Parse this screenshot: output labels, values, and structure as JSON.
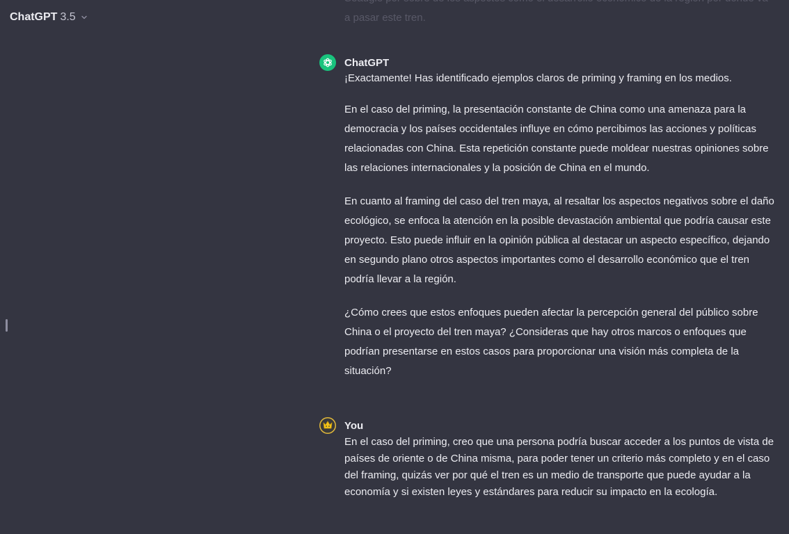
{
  "header": {
    "model_name": "ChatGPT",
    "model_version": "3.5"
  },
  "previous_message_tail": "Seaugie por sobre de los aspectos como el desarrollo económico de la región por donde va a pasar este tren.",
  "messages": [
    {
      "author": "ChatGPT",
      "role": "assistant",
      "avatar_icon": "openai-logo-icon",
      "paragraphs": [
        "¡Exactamente! Has identificado ejemplos claros de priming y framing en los medios.",
        "En el caso del priming, la presentación constante de China como una amenaza para la democracia y los países occidentales influye en cómo percibimos las acciones y políticas relacionadas con China. Esta repetición constante puede moldear nuestras opiniones sobre las relaciones internacionales y la posición de China en el mundo.",
        "En cuanto al framing del caso del tren maya, al resaltar los aspectos negativos sobre el daño ecológico, se enfoca la atención en la posible devastación ambiental que podría causar este proyecto. Esto puede influir en la opinión pública al destacar un aspecto específico, dejando en segundo plano otros aspectos importantes como el desarrollo económico que el tren podría llevar a la región.",
        "¿Cómo crees que estos enfoques pueden afectar la percepción general del público sobre China o el proyecto del tren maya? ¿Consideras que hay otros marcos o enfoques que podrían presentarse en estos casos para proporcionar una visión más completa de la situación?"
      ]
    },
    {
      "author": "You",
      "role": "user",
      "avatar_icon": "user-avatar-icon",
      "paragraphs": [
        "En el caso del priming, creo que una persona podría buscar acceder a los puntos de vista de países de oriente o de China misma, para poder tener un criterio más completo y en el caso del framing, quizás ver por qué el tren es un medio de transporte que puede ayudar a la economía y si existen leyes y estándares para reducir su impacto en la ecología."
      ]
    }
  ],
  "colors": {
    "background": "#343541",
    "text": "#ececf1",
    "gpt_avatar": "#19c37d",
    "user_avatar_accent": "#f5c518"
  }
}
